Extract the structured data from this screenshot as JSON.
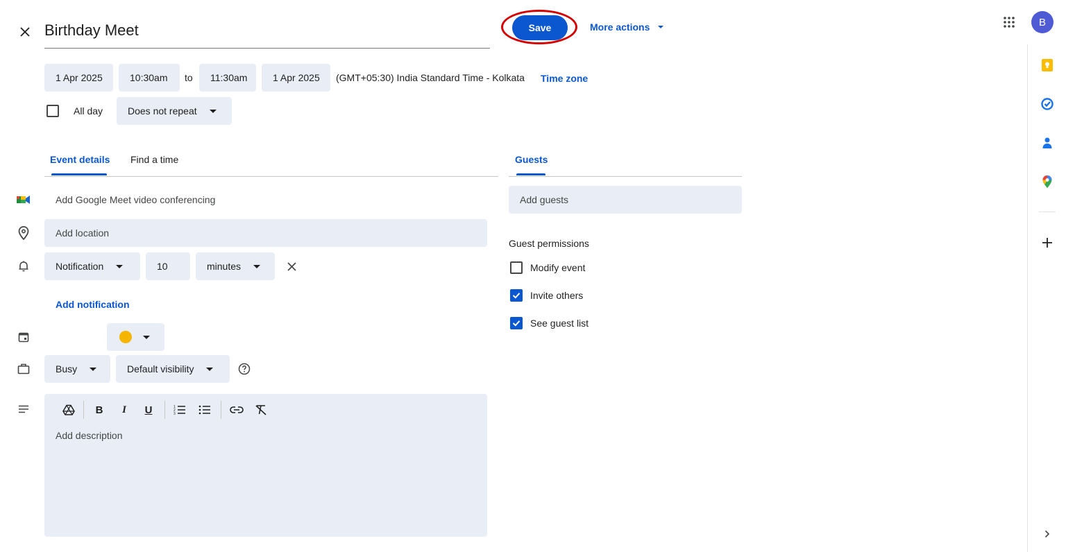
{
  "event": {
    "title": "Birthday Meet"
  },
  "header": {
    "save_label": "Save",
    "more_actions_label": "More actions"
  },
  "datetime": {
    "start_date": "1 Apr 2025",
    "start_time": "10:30am",
    "to_label": "to",
    "end_time": "11:30am",
    "end_date": "1 Apr 2025",
    "timezone_text": "(GMT+05:30) India Standard Time - Kolkata",
    "timezone_link": "Time zone",
    "all_day_label": "All day",
    "all_day_checked": false,
    "repeat_value": "Does not repeat"
  },
  "tabs": {
    "event_details": "Event details",
    "find_a_time": "Find a time",
    "guests": "Guests"
  },
  "details": {
    "meet_label": "Add Google Meet video conferencing",
    "location_placeholder": "Add location",
    "notification_type": "Notification",
    "notification_amount": "10",
    "notification_unit": "minutes",
    "add_notification": "Add notification",
    "event_color": "#f4b400",
    "availability": "Busy",
    "visibility": "Default visibility",
    "description_placeholder": "Add description"
  },
  "guests": {
    "add_placeholder": "Add guests",
    "permissions_heading": "Guest permissions",
    "permissions": [
      {
        "label": "Modify event",
        "checked": false
      },
      {
        "label": "Invite others",
        "checked": true
      },
      {
        "label": "See guest list",
        "checked": true
      }
    ]
  },
  "account": {
    "avatar_letter": "B",
    "avatar_color": "#4f5bd5"
  },
  "colors": {
    "accent": "#0b57d0",
    "field_bg": "#e9edf5",
    "highlight_ring": "#d50000"
  }
}
